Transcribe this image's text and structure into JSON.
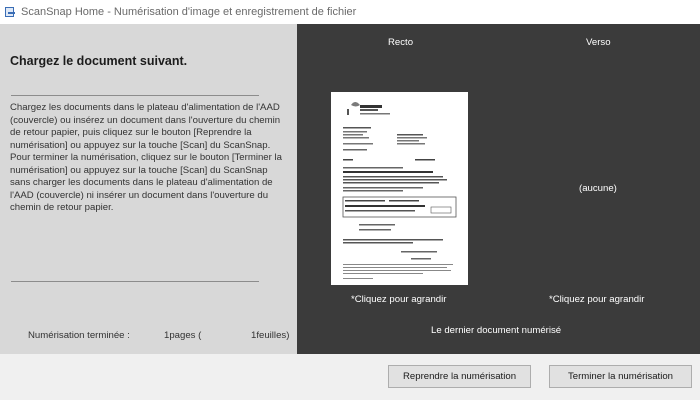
{
  "window": {
    "title": "ScanSnap Home - Numérisation d'image et enregistrement de fichier",
    "icon": "scansnap-app-icon"
  },
  "left_panel": {
    "heading": "Chargez le document suivant.",
    "instructions": "Chargez les documents dans le plateau d'alimentation de l'AAD\n(couvercle) ou insérez un document dans l'ouverture du chemin\nde retour papier, puis cliquez sur le bouton [Reprendre la\nnumérisation] ou appuyez sur la touche [Scan] du ScanSnap.\nPour terminer la numérisation, cliquez sur le bouton [Terminer la\nnumérisation] ou appuyez sur la touche [Scan] du ScanSnap\nsans charger les documents dans le plateau d'alimentation de\nl'AAD (couvercle) ni insérer un document dans l'ouverture du\nchemin de retour papier.",
    "status": {
      "label": "Numérisation terminée :",
      "pages": "1pages (",
      "sheets": "1feuilles)"
    }
  },
  "preview": {
    "front_label": "Recto",
    "back_label": "Verso",
    "back_empty_text": "(aucune)",
    "front_zoom_text": "*Cliquez pour agrandir",
    "back_zoom_text": "*Cliquez pour agrandir",
    "caption": "Le dernier document numérisé"
  },
  "buttons": {
    "resume_label": "Reprendre la numérisation",
    "finish_label": "Terminer la numérisation"
  },
  "colors": {
    "left_panel_bg": "#d8d8d8",
    "preview_bg": "#3b3b3b",
    "footer_bg": "#f0f0f0",
    "button_bg": "#e1e1e1"
  }
}
